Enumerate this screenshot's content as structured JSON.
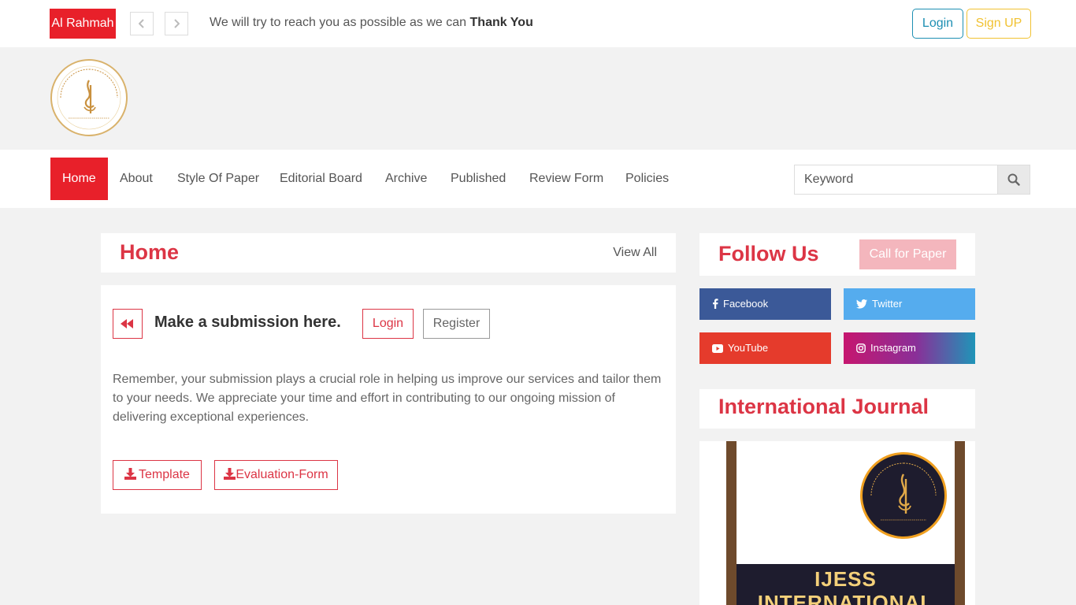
{
  "topbar": {
    "brand": "Al Rahmah",
    "ticker_prev_icon": "chevron-left-icon",
    "ticker_next_icon": "chevron-right-icon",
    "ticker_text": "We will try to reach you as possible as we can",
    "ticker_bold": "Thank You",
    "login_label": "Login",
    "signup_label": "Sign UP"
  },
  "header": {
    "logo_text": "AL-RAHMAH FOUNDATION"
  },
  "nav": {
    "items": [
      {
        "label": "Home",
        "active": true
      },
      {
        "label": "About"
      },
      {
        "label": "Style Of Paper"
      },
      {
        "label": "Editorial Board"
      },
      {
        "label": "Archive"
      },
      {
        "label": "Published"
      },
      {
        "label": "Review Form"
      },
      {
        "label": "Policies"
      }
    ],
    "search_placeholder": "Keyword",
    "search_icon": "search-icon"
  },
  "main": {
    "title": "Home",
    "view_all": "View All",
    "submit_label": "Make a submission here.",
    "login_label": "Login",
    "register_label": "Register",
    "remember_text": "Remember, your submission plays a crucial role in helping us improve our services and tailor them to your needs. We appreciate your time and effort in contributing to our ongoing mission of delivering exceptional experiences.",
    "template_label": "Template",
    "eval_label": "Evaluation-Form"
  },
  "sidebar": {
    "follow_title": "Follow Us",
    "cfp_label": "Call for Paper",
    "socials": {
      "facebook": "Facebook",
      "twitter": "Twitter",
      "youtube": "YouTube",
      "instagram": "Instagram"
    },
    "journal_title": "International Journal",
    "cover_line1": "IJESS",
    "cover_line2": "INTERNATIONAL"
  },
  "colors": {
    "accent_red": "#e8202a",
    "title_red": "#dc3545",
    "login_teal": "#1d8fb3",
    "signup_yellow": "#f1c232",
    "facebook": "#3b5998",
    "twitter": "#55acee",
    "youtube": "#e53b2c"
  }
}
